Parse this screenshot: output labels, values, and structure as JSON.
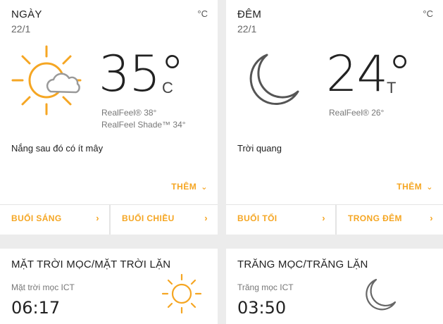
{
  "day": {
    "label": "NGÀY",
    "date": "22/1",
    "unit": "°C",
    "temp": "35°",
    "temp_unit": "C",
    "realfeel": "RealFeel® 38°",
    "realfeel_shade": "RealFeel Shade™ 34°",
    "description": "Nắng sau đó có ít mây",
    "more_label": "THÊM",
    "tabs": [
      {
        "label": "BUỔI SÁNG"
      },
      {
        "label": "BUỔI CHIỀU"
      }
    ],
    "icon": "sun-partly-cloudy-icon"
  },
  "night": {
    "label": "ĐÊM",
    "date": "22/1",
    "unit": "°C",
    "temp": "24°",
    "temp_unit": "T",
    "realfeel": "RealFeel® 26°",
    "description": "Trời quang",
    "more_label": "THÊM",
    "tabs": [
      {
        "label": "BUỔI TỐI"
      },
      {
        "label": "TRONG ĐÊM"
      }
    ],
    "icon": "moon-icon"
  },
  "sun": {
    "title": "MẶT TRỜI MỌC/MẶT TRỜI LẶN",
    "rise_label": "Mặt trời mọc ICT",
    "rise_time": "06:17",
    "icon": "sun-icon"
  },
  "moon": {
    "title": "TRĂNG MỌC/TRĂNG LẶN",
    "rise_label": "Trăng mọc ICT",
    "rise_time": "03:50",
    "icon": "moon-icon"
  },
  "colors": {
    "accent": "#f5a623",
    "icon_gray": "#555555"
  }
}
